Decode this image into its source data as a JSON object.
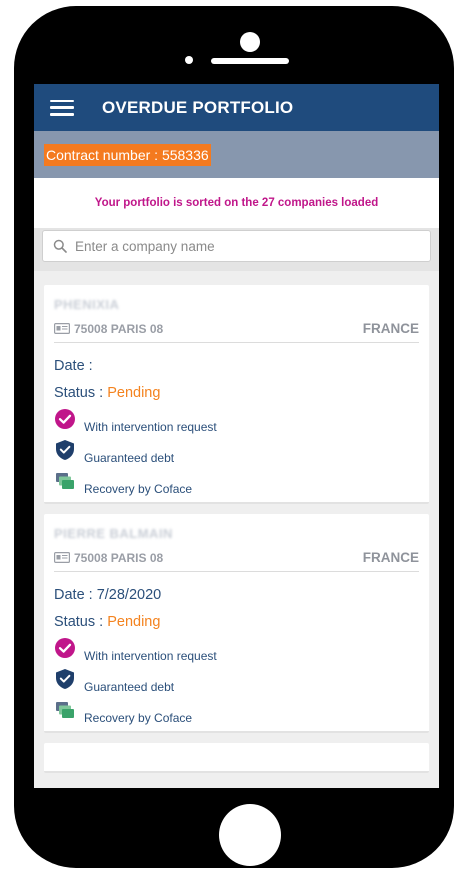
{
  "header": {
    "title": "OVERDUE PORTFOLIO",
    "menu_icon": "hamburger-menu-icon"
  },
  "contract": {
    "text": "Contract number : 558336"
  },
  "sort_info": "Your portfolio is sorted on the 27 companies loaded",
  "search": {
    "placeholder": "Enter a company name",
    "value": ""
  },
  "cards": [
    {
      "company": "PHENIXIA",
      "address": "75008 PARIS 08",
      "country": "FRANCE",
      "date_text": "Date :",
      "status_label": "Status : ",
      "status_value": "Pending",
      "flags": {
        "intervention": "With intervention request",
        "guaranteed": "Guaranteed debt",
        "recovery": "Recovery by Coface"
      }
    },
    {
      "company": "PIERRE BALMAIN",
      "address": "75008 PARIS 08",
      "country": "FRANCE",
      "date_text": "Date : 7/28/2020",
      "status_label": "Status : ",
      "status_value": "Pending",
      "flags": {
        "intervention": "With intervention request",
        "guaranteed": "Guaranteed debt",
        "recovery": "Recovery by Coface"
      }
    }
  ],
  "colors": {
    "header_bg": "#1f4b7d",
    "contract_bar_bg": "#8797ae",
    "contract_highlight": "#f47a1f",
    "sort_info_text": "#c0168a",
    "status_pending": "#f4831f",
    "check_icon": "#c0168a",
    "shield_icon": "#1f3f6b",
    "recovery_icon": "#3aa36a"
  }
}
